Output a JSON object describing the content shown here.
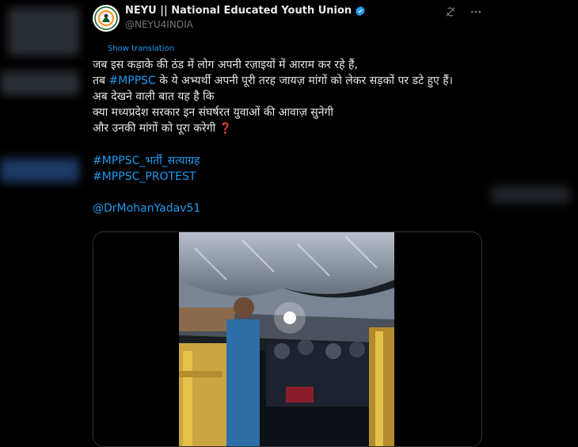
{
  "account": {
    "display_name": "NEYU || National Educated Youth Union",
    "handle": "@NEYU4INDIA",
    "verified": true,
    "avatar_icon": "emblem-logo-icon"
  },
  "actions": {
    "grok_icon": "grok-icon",
    "more_icon": "more-dots-icon"
  },
  "translate_label": "Show translation",
  "tweet": {
    "line1": "जब इस कड़ाके की ठंड में लोग अपनी रज़ाइयों में आराम कर रहे हैं,",
    "line2_pre": "तब ",
    "line2_tag": "#MPPSC",
    "line2_post": " के ये अभ्यर्थी अपनी पूरी तरह जायज़ मांगों को लेकर सड़कों पर डटे हुए हैं।",
    "line3": "अब देखने वाली बात यह है कि",
    "line4": "क्या मध्यप्रदेश सरकार इन संघर्षरत युवाओं की आवाज़ सुनेगी",
    "line5": "और उनकी मांगों को पूरा करेगी",
    "line5_emoji": "❓",
    "hashtag1": "#MPPSC_भर्ती_सत्याग्रह",
    "hashtag2": "#MPPSC_PROTEST",
    "mention": "@DrMohanYadav51"
  },
  "colors": {
    "background": "#000000",
    "text": "#e7e9ea",
    "link": "#1d9bf0",
    "muted": "#71767b",
    "verified": "#1d9bf0"
  },
  "media": {
    "type": "video",
    "description_icon": "video-thumbnail"
  }
}
